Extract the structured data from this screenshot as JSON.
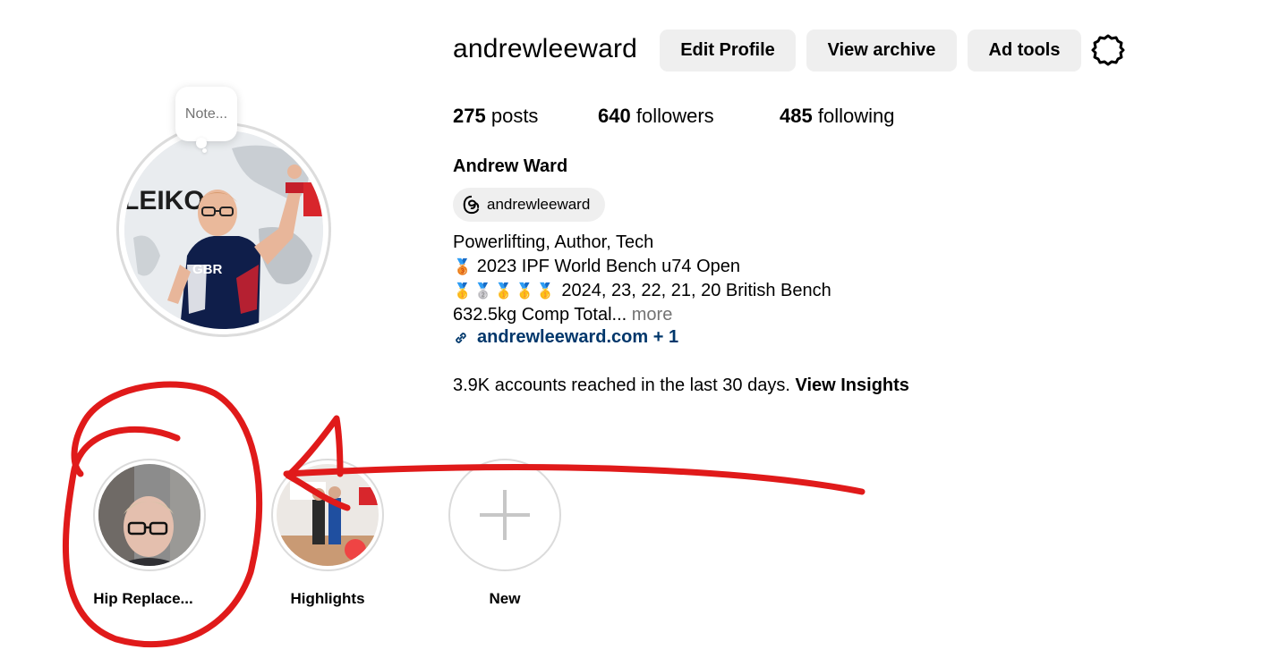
{
  "profile": {
    "username": "andrewleeward",
    "note_placeholder": "Note...",
    "full_name": "Andrew Ward",
    "threads_handle": "andrewleeward"
  },
  "actions": {
    "edit_profile": "Edit Profile",
    "view_archive": "View archive",
    "ad_tools": "Ad tools"
  },
  "stats": {
    "posts_count": "275",
    "posts_label": "posts",
    "followers_count": "640",
    "followers_label": "followers",
    "following_count": "485",
    "following_label": "following"
  },
  "bio": {
    "line1": "Powerlifting, Author, Tech",
    "line2_medals": "🥉",
    "line2": "2023 IPF World Bench u74 Open",
    "line3_medals": "🥇🥈🥇🥇🥇",
    "line3": "2024, 23, 22, 21, 20 British Bench",
    "line4": "632.5kg Comp Total...",
    "more_label": "more",
    "link": "andrewleeward.com + 1"
  },
  "insights": {
    "reach_text": "3.9K accounts reached in the last 30 days.",
    "view_insights": "View Insights"
  },
  "highlights": [
    {
      "label": "Hip Replace..."
    },
    {
      "label": "Highlights"
    },
    {
      "label": "New"
    }
  ],
  "colors": {
    "button_bg": "#efefef",
    "link": "#00376b",
    "muted": "#737373",
    "annotation_red": "#e01a1a"
  },
  "icons": {
    "settings": "gear-icon",
    "threads": "threads-icon",
    "link": "link-icon",
    "new_highlight": "plus-icon"
  }
}
